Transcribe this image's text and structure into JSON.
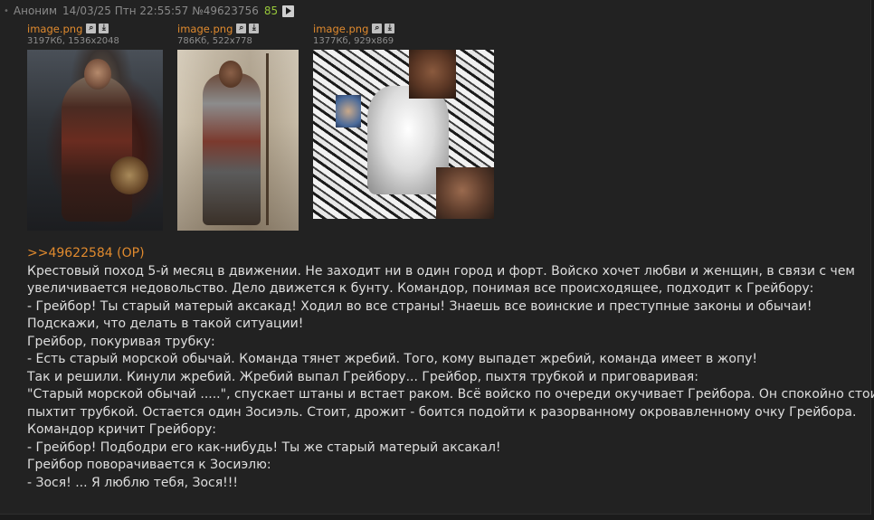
{
  "post": {
    "author": "Аноним",
    "date": "14/03/25 Птн 22:55:57",
    "number": "№49623756",
    "reply_count": "85",
    "files": [
      {
        "name": "image.png",
        "size": "3197Кб, 1536x2048"
      },
      {
        "name": "image.png",
        "size": "786Кб, 522x778"
      },
      {
        "name": "image.png",
        "size": "1377Кб, 929x869"
      }
    ],
    "reply_link": ">>49622584 (OP)",
    "lines": [
      "Крестовый поход 5-й месяц в движении. Не заходит ни в один город и форт. Войско хочет любви и женщин, в связи с чем",
      "увеличивается недовольство. Дело движется к бунту. Командор, понимая все происходящее, подходит к Грейбору:",
      "- Грейбор! Ты старый матерый аксакад! Ходил во все страны! Знаешь все воинские и преступные законы и обычаи!",
      "Подскажи, что делать в такой ситуации!",
      "Грейбор, покуривая трубку:",
      "- Есть старый морской обычай. Команда тянет жребий. Того, кому выпадет жребий, команда имеет в жопу!",
      "Так и решили. Кинули жребий. Жребий выпал Грейбору... Грейбор, пыхтя трубкой и приговаривая:",
      "\"Старый морской обычай .....\", спускает штаны и встает раком. Всё войско по очереди окучивает Грейбора. Он спокойно стоит и",
      "пыхтит трубкой. Остается один Зосиэль. Стоит, дрожит - боится подойти к разорванному окровавленному очку Грейбора.",
      "Командор кричит Грейбору:",
      "- Грейбор! Подбодри его как-нибудь! Ты же старый матерый аксакал!",
      "Грейбор поворачивается к Зосиэлю:",
      "- Зося! ... Я люблю тебя, Зося!!!"
    ]
  },
  "icons": {
    "header_dot": "bullet-icon",
    "play": "play-icon",
    "search": "search-icon",
    "download": "download-icon"
  },
  "colors": {
    "background": "#222222",
    "text": "#dedede",
    "meta": "#8a8a8a",
    "link": "#e08a2e",
    "reply_count": "#97c73a"
  }
}
